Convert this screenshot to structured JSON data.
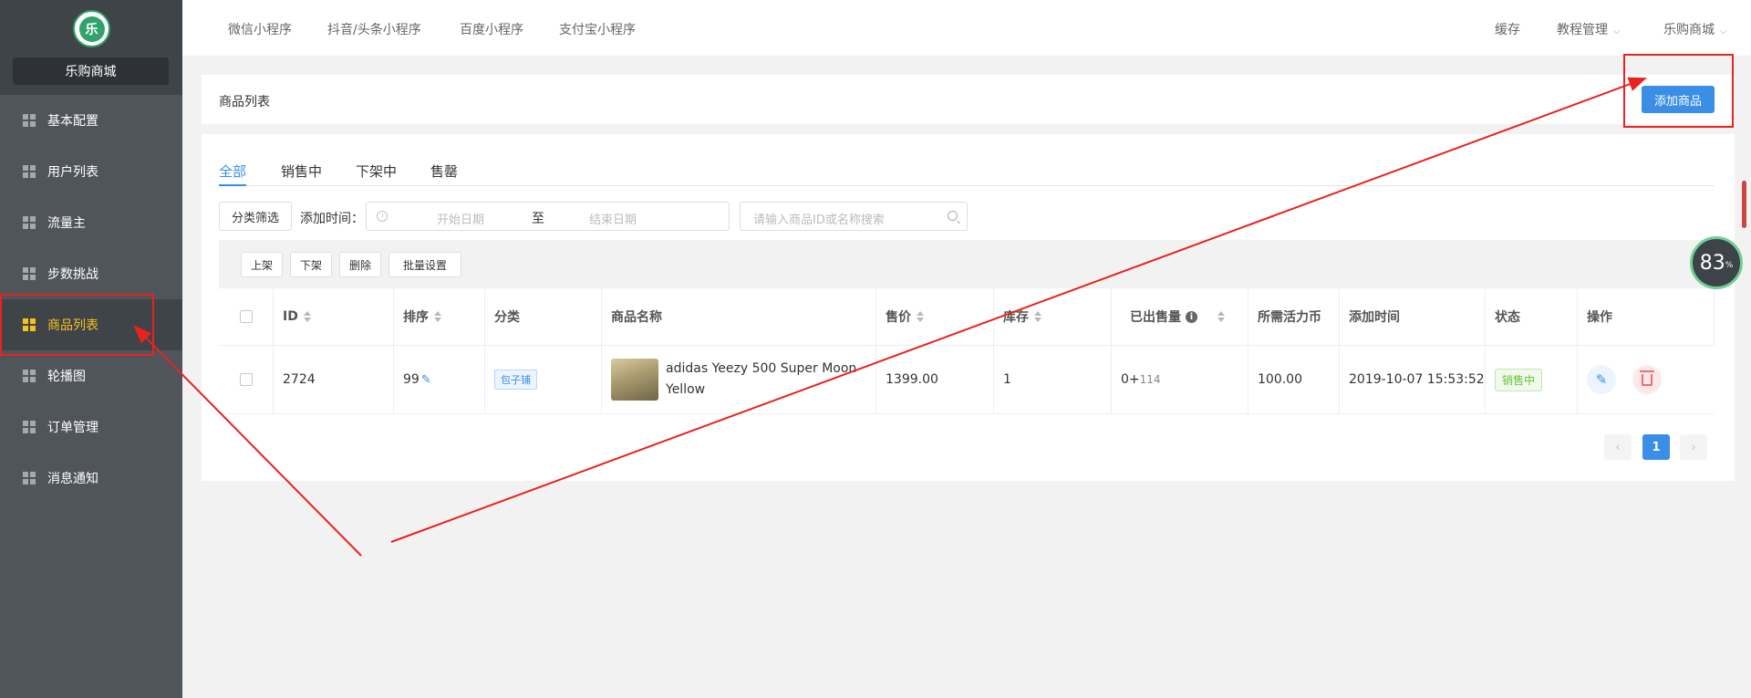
{
  "sidebar": {
    "shop_name": "乐购商城",
    "logo_glyph": "乐",
    "items": [
      {
        "label": "基本配置",
        "icon": "grid-icon"
      },
      {
        "label": "用户列表",
        "icon": "grid-icon"
      },
      {
        "label": "流量主",
        "icon": "grid-icon"
      },
      {
        "label": "步数挑战",
        "icon": "grid-icon"
      },
      {
        "label": "商品列表",
        "icon": "grid-icon",
        "active": true
      },
      {
        "label": "轮播图",
        "icon": "grid-icon"
      },
      {
        "label": "订单管理",
        "icon": "grid-icon"
      },
      {
        "label": "消息通知",
        "icon": "grid-icon"
      }
    ]
  },
  "topbar": {
    "tabs": [
      "微信小程序",
      "抖音/头条小程序",
      "百度小程序",
      "支付宝小程序"
    ],
    "cache": "缓存",
    "tutorial": "教程管理",
    "account": "乐购商城"
  },
  "header": {
    "title": "商品列表",
    "add_button": "添加商品"
  },
  "tabs": [
    "全部",
    "销售中",
    "下架中",
    "售罄"
  ],
  "filters": {
    "category_button": "分类筛选",
    "date_label": "添加时间：",
    "date_start_placeholder": "开始日期",
    "date_separator": "至",
    "date_end_placeholder": "结束日期",
    "search_placeholder": "请输入商品ID或名称搜索"
  },
  "bulk_actions": [
    "上架",
    "下架",
    "删除",
    "批量设置"
  ],
  "table": {
    "headers": [
      "ID",
      "排序",
      "分类",
      "商品名称",
      "售价",
      "库存",
      "已出售量",
      "所需活力币",
      "添加时间",
      "状态",
      "操作"
    ],
    "rows": [
      {
        "id": "2724",
        "sort": "99",
        "category": "包子铺",
        "name": "adidas Yeezy 500 Super Moon Yellow",
        "price": "1399.00",
        "stock": "1",
        "sold_base": "0+",
        "sold_extra": "114",
        "coins": "100.00",
        "added": "2019-10-07 15:53:52",
        "status": "销售中"
      }
    ]
  },
  "pagination": {
    "current": "1"
  },
  "widget": {
    "percent": "83",
    "unit": "%"
  },
  "colors": {
    "accent": "#3a8ee6",
    "active_menu": "#f5c21a",
    "annotation": "#e8231f"
  }
}
